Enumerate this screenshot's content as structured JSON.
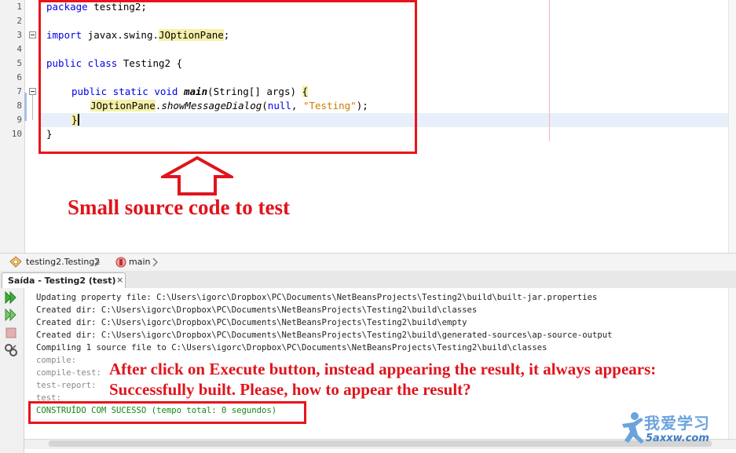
{
  "editor": {
    "line_numbers": [
      "1",
      "2",
      "3",
      "4",
      "5",
      "6",
      "7",
      "8",
      "9",
      "10"
    ],
    "code": {
      "l1_kw": "package",
      "l1_rest": " testing2;",
      "l3_kw": "import",
      "l3_pkg": " javax.swing.",
      "l3_cls": "JOptionPane",
      "l3_end": ";",
      "l5_kw": "public class",
      "l5_rest": " Testing2 {",
      "l7_kw": "public static void",
      "l7_sp": " ",
      "l7_method": "main",
      "l7_args": "(String[] args) ",
      "l7_brace": "{",
      "l8_cls": "JOptionPane",
      "l8_dot": ".",
      "l8_method": "showMessageDialog",
      "l8_open": "(",
      "l8_null": "null",
      "l8_comma": ", ",
      "l8_str": "\"Testing\"",
      "l8_end": ");",
      "l9_brace": "}",
      "l10_brace": "}"
    }
  },
  "annotations": {
    "source_caption": "Small source code to test",
    "result_question": "After click on Execute button, instead appearing the result, it always appears: Successfully built. Please, how to appear the result?"
  },
  "breadcrumb": {
    "class_label": "testing2.Testing2",
    "method_label": "main"
  },
  "output": {
    "tab_label": "Saída - Testing2 (test)",
    "close_glyph": "×",
    "lines": [
      "Updating property file: C:\\Users\\igorc\\Dropbox\\PC\\Documents\\NetBeansProjects\\Testing2\\build\\built-jar.properties",
      "Created dir: C:\\Users\\igorc\\Dropbox\\PC\\Documents\\NetBeansProjects\\Testing2\\build\\classes",
      "Created dir: C:\\Users\\igorc\\Dropbox\\PC\\Documents\\NetBeansProjects\\Testing2\\build\\empty",
      "Created dir: C:\\Users\\igorc\\Dropbox\\PC\\Documents\\NetBeansProjects\\Testing2\\build\\generated-sources\\ap-source-output",
      "Compiling 1 source file to C:\\Users\\igorc\\Dropbox\\PC\\Documents\\NetBeansProjects\\Testing2\\build\\classes",
      "compile:",
      "compile-test:",
      "test-report:",
      "test:"
    ],
    "success_line": "CONSTRUÍDO COM SUCESSO (tempo total: 0 segundos)"
  },
  "watermark": {
    "text": "我爱学习",
    "url": "5axxw.com"
  },
  "colors": {
    "annotation_red": "#e0141c",
    "keyword_blue": "#0000e6",
    "string_orange": "#ce7b00",
    "success_green": "#138a13"
  }
}
